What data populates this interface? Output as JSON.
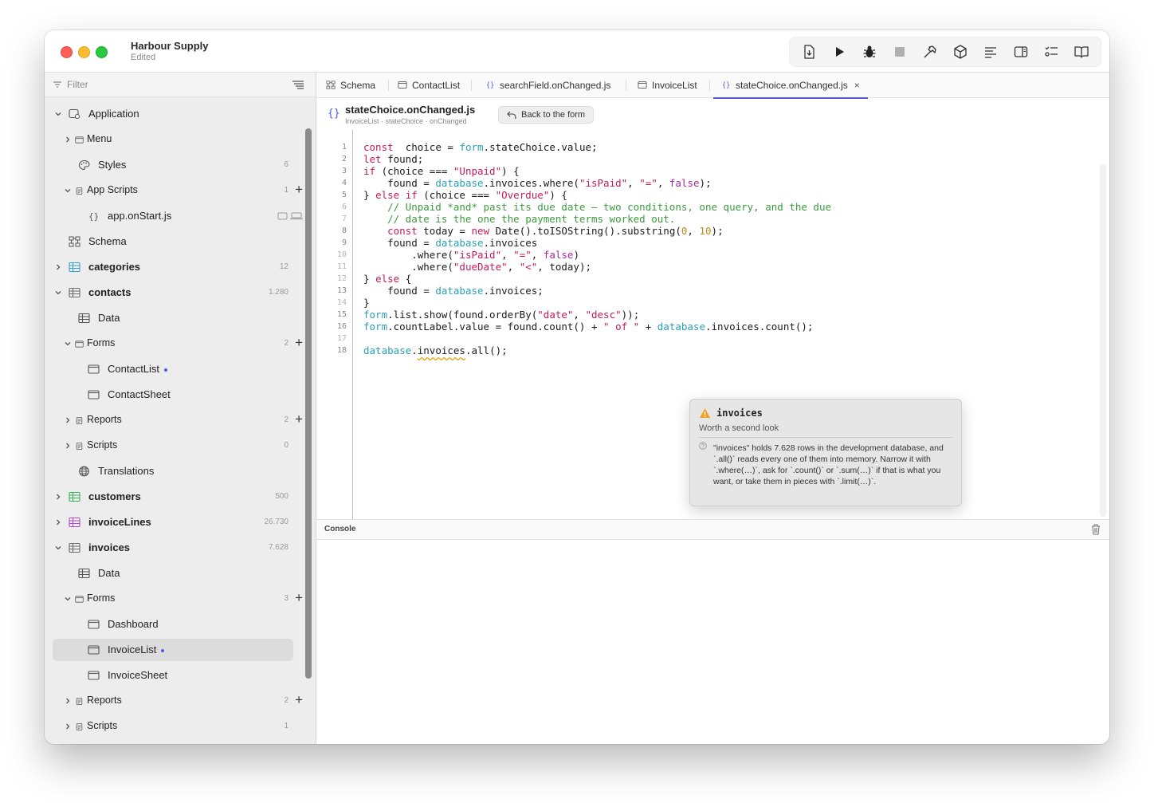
{
  "window": {
    "title": "Harbour Supply",
    "subtitle": "Edited"
  },
  "toolbar": {
    "buttons": [
      "export-icon",
      "run-icon",
      "debug-icon",
      "stop-icon",
      "build-icon",
      "package-icon",
      "outline-icon",
      "panel-icon",
      "checklist-icon",
      "book-icon"
    ]
  },
  "sidebar": {
    "filter_placeholder": "Filter",
    "items": [
      {
        "label": "Application",
        "icon": "application-icon",
        "depth": 0,
        "chevron": "down"
      },
      {
        "label": "Menu",
        "icon": "window-icon",
        "depth": 1,
        "chevron": "right"
      },
      {
        "label": "Styles",
        "icon": "palette-icon",
        "depth": 1,
        "count": "6"
      },
      {
        "label": "App Scripts",
        "icon": "script-icon",
        "depth": 1,
        "chevron": "down",
        "count": "1",
        "plus": true
      },
      {
        "label": "app.onStart.js",
        "icon": "braces-icon",
        "depth": 2,
        "badges": true
      },
      {
        "label": "Schema",
        "icon": "schema-icon",
        "depth": 0
      },
      {
        "label": "categories",
        "icon": "table-icon",
        "depth": 0,
        "chevron": "right",
        "count": "12",
        "bold": true,
        "color": "#3aa0c8"
      },
      {
        "label": "contacts",
        "icon": "table-icon",
        "depth": 0,
        "chevron": "down",
        "count": "1.280",
        "bold": true,
        "color": "#6a6a6a"
      },
      {
        "label": "Data",
        "icon": "table-icon",
        "depth": 1
      },
      {
        "label": "Forms",
        "icon": "form-icon",
        "depth": 1,
        "chevron": "down",
        "count": "2",
        "plus": true
      },
      {
        "label": "ContactList",
        "icon": "form-icon",
        "depth": 2,
        "dot": true
      },
      {
        "label": "ContactSheet",
        "icon": "form-icon",
        "depth": 2
      },
      {
        "label": "Reports",
        "icon": "report-icon",
        "depth": 1,
        "chevron": "right",
        "count": "2",
        "plus": true
      },
      {
        "label": "Scripts",
        "icon": "script-icon",
        "depth": 1,
        "chevron": "right",
        "count": "0"
      },
      {
        "label": "Translations",
        "icon": "globe-icon",
        "depth": 1
      },
      {
        "label": "customers",
        "icon": "table-icon",
        "depth": 0,
        "chevron": "right",
        "count": "500",
        "bold": true,
        "color": "#3bb05a"
      },
      {
        "label": "invoiceLines",
        "icon": "table-icon",
        "depth": 0,
        "chevron": "right",
        "count": "26.730",
        "bold": true,
        "color": "#b04ac8"
      },
      {
        "label": "invoices",
        "icon": "table-icon",
        "depth": 0,
        "chevron": "down",
        "count": "7.628",
        "bold": true,
        "color": "#6a6a6a"
      },
      {
        "label": "Data",
        "icon": "table-icon",
        "depth": 1
      },
      {
        "label": "Forms",
        "icon": "form-icon",
        "depth": 1,
        "chevron": "down",
        "count": "3",
        "plus": true
      },
      {
        "label": "Dashboard",
        "icon": "form-icon",
        "depth": 2
      },
      {
        "label": "InvoiceList",
        "icon": "form-icon",
        "depth": 2,
        "dot": true,
        "selected": true
      },
      {
        "label": "InvoiceSheet",
        "icon": "form-icon",
        "depth": 2
      },
      {
        "label": "Reports",
        "icon": "report-icon",
        "depth": 1,
        "chevron": "right",
        "count": "2",
        "plus": true
      },
      {
        "label": "Scripts",
        "icon": "script-icon",
        "depth": 1,
        "chevron": "right",
        "count": "1"
      }
    ]
  },
  "tabs": [
    {
      "label": "Schema",
      "icon": "schema-icon"
    },
    {
      "label": "ContactList",
      "icon": "form-icon"
    },
    {
      "label": "searchField.onChanged.js",
      "icon": "braces-icon"
    },
    {
      "label": "InvoiceList",
      "icon": "form-icon"
    },
    {
      "label": "stateChoice.onChanged.js",
      "icon": "braces-icon",
      "active": true,
      "closable": true
    }
  ],
  "editor": {
    "file_title": "stateChoice.onChanged.js",
    "breadcrumb": "InvoiceList · stateChoice · onChanged",
    "back_button": "Back to the form",
    "line_numbers": [
      "1",
      "2",
      "3",
      "4",
      "5",
      "6",
      "7",
      "8",
      "9",
      "10",
      "11",
      "12",
      "13",
      "14",
      "15",
      "16",
      "17",
      "18"
    ],
    "lines": [
      [
        [
          "kw",
          "const"
        ],
        [
          "",
          "  choice = "
        ],
        [
          "obj",
          "form"
        ],
        [
          "",
          ".stateChoice.value;"
        ]
      ],
      [
        [
          "kw",
          "let"
        ],
        [
          "",
          " found;"
        ]
      ],
      [
        [
          "kw",
          "if"
        ],
        [
          "",
          " (choice === "
        ],
        [
          "str",
          "\"Unpaid\""
        ],
        [
          "",
          ") {"
        ]
      ],
      [
        [
          "",
          "    found = "
        ],
        [
          "obj",
          "database"
        ],
        [
          "",
          ".invoices.where("
        ],
        [
          "str",
          "\"isPaid\""
        ],
        [
          "",
          ", "
        ],
        [
          "str",
          "\"=\""
        ],
        [
          "",
          ", "
        ],
        [
          "bool",
          "false"
        ],
        [
          "",
          ");"
        ]
      ],
      [
        [
          "",
          "} "
        ],
        [
          "kw",
          "else if"
        ],
        [
          "",
          " (choice === "
        ],
        [
          "str",
          "\"Overdue\""
        ],
        [
          "",
          ") {"
        ]
      ],
      [
        [
          "cmt",
          "    // Unpaid *and* past its due date — two conditions, one query, and the due"
        ]
      ],
      [
        [
          "cmt",
          "    // date is the one the payment terms worked out."
        ]
      ],
      [
        [
          "",
          "    "
        ],
        [
          "kw",
          "const"
        ],
        [
          "",
          " today = "
        ],
        [
          "kw",
          "new"
        ],
        [
          "",
          " Date().toISOString().substring("
        ],
        [
          "num",
          "0"
        ],
        [
          "",
          ", "
        ],
        [
          "num",
          "10"
        ],
        [
          "",
          ");"
        ]
      ],
      [
        [
          "",
          "    found = "
        ],
        [
          "obj",
          "database"
        ],
        [
          "",
          ".invoices"
        ]
      ],
      [
        [
          "",
          "        .where("
        ],
        [
          "str",
          "\"isPaid\""
        ],
        [
          "",
          ", "
        ],
        [
          "str",
          "\"=\""
        ],
        [
          "",
          ", "
        ],
        [
          "bool",
          "false"
        ],
        [
          "",
          ")"
        ]
      ],
      [
        [
          "",
          "        .where("
        ],
        [
          "str",
          "\"dueDate\""
        ],
        [
          "",
          ", "
        ],
        [
          "str",
          "\"<\""
        ],
        [
          "",
          ", today);"
        ]
      ],
      [
        [
          "",
          "} "
        ],
        [
          "kw",
          "else"
        ],
        [
          "",
          " {"
        ]
      ],
      [
        [
          "",
          "    found = "
        ],
        [
          "obj",
          "database"
        ],
        [
          "",
          ".invoices;"
        ]
      ],
      [
        [
          "",
          "}"
        ]
      ],
      [
        [
          "obj",
          "form"
        ],
        [
          "",
          ".list.show(found.orderBy("
        ],
        [
          "str",
          "\"date\""
        ],
        [
          "",
          ", "
        ],
        [
          "str",
          "\"desc\""
        ],
        [
          "",
          "));"
        ]
      ],
      [
        [
          "obj",
          "form"
        ],
        [
          "",
          ".countLabel.value = found.count() + "
        ],
        [
          "str",
          "\" of \""
        ],
        [
          "",
          " + "
        ],
        [
          "obj",
          "database"
        ],
        [
          "",
          ".invoices.count();"
        ]
      ],
      [],
      [
        [
          "obj",
          "database"
        ],
        [
          "",
          "."
        ],
        [
          "sq",
          "invoices"
        ],
        [
          "",
          ".all();"
        ]
      ]
    ]
  },
  "popover": {
    "title": "invoices",
    "subtitle": "Worth a second look",
    "body": "\"invoices\" holds 7.628 rows in the development database, and `.all()` reads every one of them into memory. Narrow it with `.where(…)`, ask for `.count()` or `.sum(…)` if that is what you want, or take them in pieces with `.limit(…)`."
  },
  "console": {
    "label": "Console"
  }
}
